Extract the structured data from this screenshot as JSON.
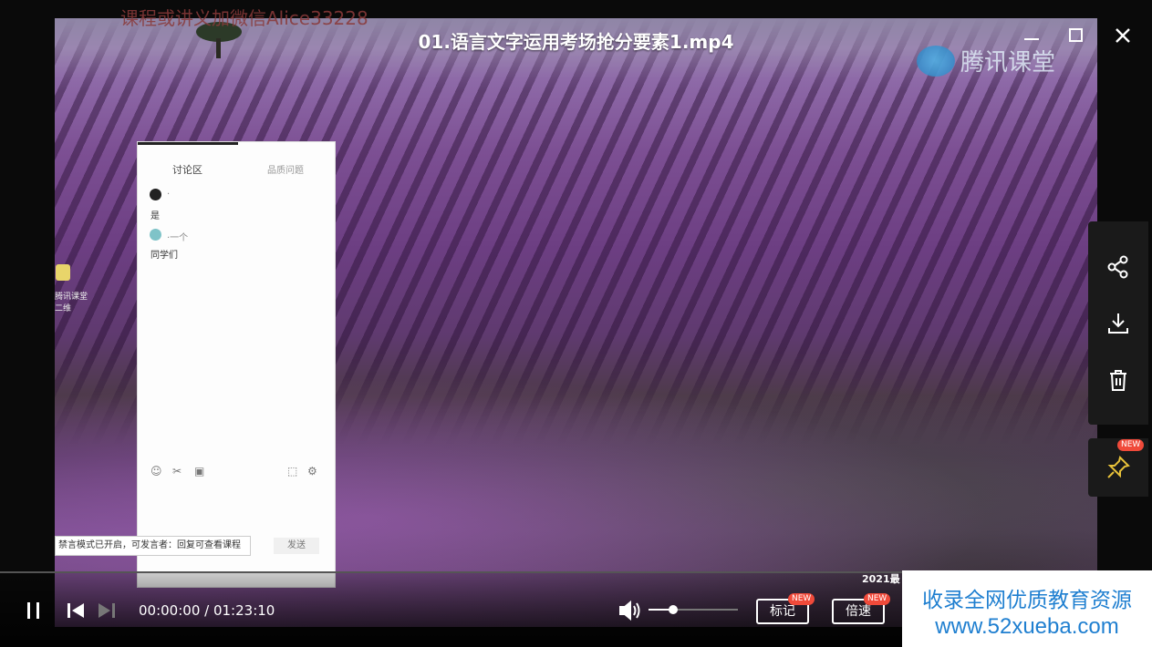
{
  "window": {
    "title": "01.语言文字运用考场抢分要素1.mp4",
    "watermark_text": "课程或讲义加微信Alice33228",
    "logo_text": "腾讯课堂"
  },
  "video_overlay": {
    "panel_title": "讨论区",
    "panel_link": "品质问题",
    "messages": [
      {
        "name": "·",
        "text": "是",
        "avatar_color": "#222222"
      },
      {
        "name": "·一个",
        "text": "同学们",
        "avatar_color": "#7fc3c8"
      }
    ],
    "notice_text": "禁言模式已开启，可发言者：回复可查看课程",
    "send_label": "发送",
    "desktop_label": "腾讯课堂\n二维"
  },
  "side_actions": {
    "share": "share-icon",
    "download": "download-icon",
    "delete": "trash-icon",
    "pin": "pin-icon",
    "pin_badge": "NEW"
  },
  "player": {
    "current_time": "00:00:00",
    "duration": "01:23:10",
    "time_separator": " / ",
    "volume_level": 0.28,
    "mark_label": "标记",
    "mark_badge": "NEW",
    "speed_label": "倍速",
    "speed_badge": "NEW",
    "year_text": "2021最"
  },
  "ad": {
    "line1": "收录全网优质教育资源",
    "line2": "www.52xueba.com"
  },
  "colors": {
    "accent_blue": "#1f7fd0",
    "badge_red": "#f04a3a"
  }
}
